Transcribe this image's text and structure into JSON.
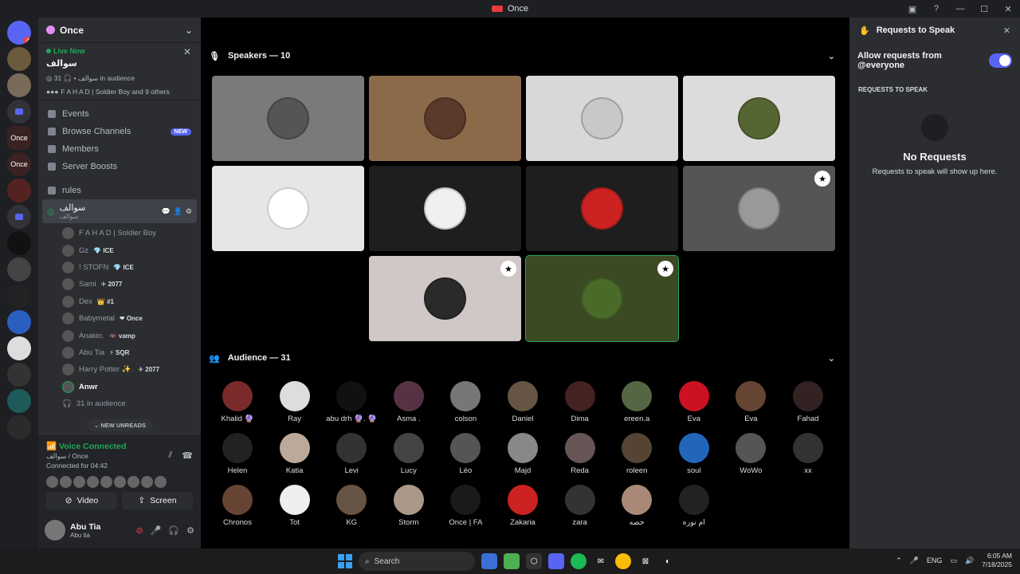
{
  "window": {
    "title": "Once"
  },
  "servers": [
    {
      "name": "discord-home",
      "label": "",
      "badge": "4",
      "color": "#5865f2"
    },
    {
      "name": "server-1",
      "label": "",
      "badge": "",
      "color": "#6b5a3c"
    },
    {
      "name": "server-2",
      "label": "",
      "badge": "",
      "color": "#7a6a5a"
    },
    {
      "name": "folder-1",
      "label": "",
      "badge": "",
      "color": "folder"
    },
    {
      "name": "server-once",
      "label": "Once",
      "badge": "",
      "color": "#3a2222"
    },
    {
      "name": "server-once-2",
      "label": "Once",
      "badge": "",
      "color": "#3a2222"
    },
    {
      "name": "server-3",
      "label": "",
      "badge": "",
      "color": "#552222"
    },
    {
      "name": "folder-2",
      "label": "",
      "badge": "",
      "color": "folder"
    },
    {
      "name": "server-4",
      "label": "",
      "badge": "",
      "color": "#111"
    },
    {
      "name": "server-5",
      "label": "",
      "badge": "",
      "color": "#444"
    },
    {
      "name": "server-6",
      "label": "",
      "badge": "",
      "color": "#222"
    },
    {
      "name": "server-7",
      "label": "",
      "badge": "",
      "color": "#2a5fbf"
    },
    {
      "name": "server-8",
      "label": "",
      "badge": "",
      "color": "#ddd"
    },
    {
      "name": "server-9",
      "label": "",
      "badge": "",
      "color": "#333"
    },
    {
      "name": "server-10",
      "label": "",
      "badge": "",
      "color": "#1e5a5a"
    },
    {
      "name": "server-11",
      "label": "",
      "badge": "",
      "color": "#2b2b2b"
    }
  ],
  "guild": {
    "name": "Once"
  },
  "live": {
    "label": "Live Now",
    "topic": "سوالف",
    "meta_channel": "سوالف",
    "meta_audience": "31 in audience",
    "members": "F A H A D | Soldier Boy and 9 others"
  },
  "nav": [
    {
      "name": "events",
      "label": "Events",
      "badge": ""
    },
    {
      "name": "browse-channels",
      "label": "Browse Channels",
      "badge": "NEW"
    },
    {
      "name": "members",
      "label": "Members",
      "badge": ""
    },
    {
      "name": "server-boosts",
      "label": "Server Boosts",
      "badge": ""
    }
  ],
  "channels": {
    "rules": "rules",
    "stage_name": "سوالف",
    "stage_topic": "سوالف"
  },
  "voice_users": [
    {
      "name": "F A H A D | Soldier Boy",
      "tag": ""
    },
    {
      "name": "Gz",
      "tag": "💎 ICE"
    },
    {
      "name": "! STOFN",
      "tag": "💎 ICE"
    },
    {
      "name": "Sami",
      "tag": "✈ 2077"
    },
    {
      "name": "Dex",
      "tag": "👑 #1"
    },
    {
      "name": "Babymetal",
      "tag": "❤ Once"
    },
    {
      "name": "Anakin.",
      "tag": "🦇 vamp"
    },
    {
      "name": "Abu Tia",
      "tag": "⚡ SQR"
    },
    {
      "name": "Harry Potter ✨.",
      "tag": "✈ 2077"
    },
    {
      "name": "Anwr",
      "tag": ""
    }
  ],
  "audience_summary": "31 in audience",
  "new_unreads": "NEW UNREADS",
  "voice": {
    "status": "Voice Connected",
    "channel": "سوالف / Once",
    "connected_for": "Connected for 04:42",
    "video": "Video",
    "screen": "Screen"
  },
  "user": {
    "name": "Abu Tia",
    "status": "Abu tia"
  },
  "stage": {
    "speakers_title": "Speakers — 10",
    "audience_title": "Audience — 31",
    "speakers": [
      {
        "bg": "#7a7a7a",
        "av": "#555555",
        "shield": false,
        "speaking": false
      },
      {
        "bg": "#8b6a4a",
        "av": "#5a3a2a",
        "shield": false,
        "speaking": false
      },
      {
        "bg": "#d8d8d8",
        "av": "#c8c8c8",
        "shield": false,
        "speaking": false
      },
      {
        "bg": "#dcdcdc",
        "av": "#556633",
        "shield": false,
        "speaking": false
      },
      {
        "bg": "#e6e6e6",
        "av": "#ffffff",
        "shield": false,
        "speaking": false
      },
      {
        "bg": "#1e1e1e",
        "av": "#f0f0f0",
        "shield": false,
        "speaking": false
      },
      {
        "bg": "#1e1e1e",
        "av": "#cc2222",
        "shield": false,
        "speaking": false
      },
      {
        "bg": "#555555",
        "av": "#999999",
        "shield": true,
        "speaking": false
      },
      {
        "bg": "#cfc8c6",
        "av": "#2a2a2a",
        "shield": true,
        "speaking": false
      },
      {
        "bg": "#3c4a24",
        "av": "#4a6a2a",
        "shield": true,
        "speaking": true
      }
    ],
    "audience": [
      {
        "name": "Khalid 🔮",
        "color": "#7a2a2a"
      },
      {
        "name": "Ray",
        "color": "#dddddd"
      },
      {
        "name": "abu drh 🔮. 🔮",
        "color": "#111111"
      },
      {
        "name": "Asma .",
        "color": "#553344"
      },
      {
        "name": "colson",
        "color": "#777777"
      },
      {
        "name": "Daniel",
        "color": "#665544"
      },
      {
        "name": "Dima",
        "color": "#442222"
      },
      {
        "name": "ereen.a",
        "color": "#556644"
      },
      {
        "name": "Eva",
        "color": "#cc1122"
      },
      {
        "name": "Eva",
        "color": "#664433"
      },
      {
        "name": "Fahad",
        "color": "#332222"
      },
      {
        "name": "Helen",
        "color": "#222222"
      },
      {
        "name": "Katia",
        "color": "#bbaa99"
      },
      {
        "name": "Levi",
        "color": "#333333"
      },
      {
        "name": "Lucy",
        "color": "#444444"
      },
      {
        "name": "Léo",
        "color": "#555555"
      },
      {
        "name": "Majd",
        "color": "#888888"
      },
      {
        "name": "Reda",
        "color": "#665555"
      },
      {
        "name": "roleen",
        "color": "#554433"
      },
      {
        "name": "soul",
        "color": "#2266bb"
      },
      {
        "name": "WoWo",
        "color": "#555555"
      },
      {
        "name": "xx",
        "color": "#333333"
      },
      {
        "name": "Chronos",
        "color": "#664433"
      },
      {
        "name": "Tot",
        "color": "#eeeeee"
      },
      {
        "name": "KG",
        "color": "#665544"
      },
      {
        "name": "Storm",
        "color": "#aa9988"
      },
      {
        "name": "Once | FA",
        "color": "#1a1a1a"
      },
      {
        "name": "Zakaria",
        "color": "#cc2222"
      },
      {
        "name": "zara",
        "color": "#333333"
      },
      {
        "name": "حصه",
        "color": "#aa8877"
      },
      {
        "name": "ام نوره",
        "color": "#222222"
      }
    ]
  },
  "requests": {
    "title": "Requests to Speak",
    "allow_label": "Allow requests from @everyone",
    "section": "REQUESTS TO SPEAK",
    "empty_title": "No Requests",
    "empty_sub": "Requests to speak will show up here."
  },
  "taskbar": {
    "search": "Search",
    "lang": "ENG",
    "time": "6:05 AM",
    "date": "7/18/2025"
  },
  "colors": {
    "accent": "#5865f2",
    "green": "#23a55a",
    "red": "#f23f43"
  }
}
